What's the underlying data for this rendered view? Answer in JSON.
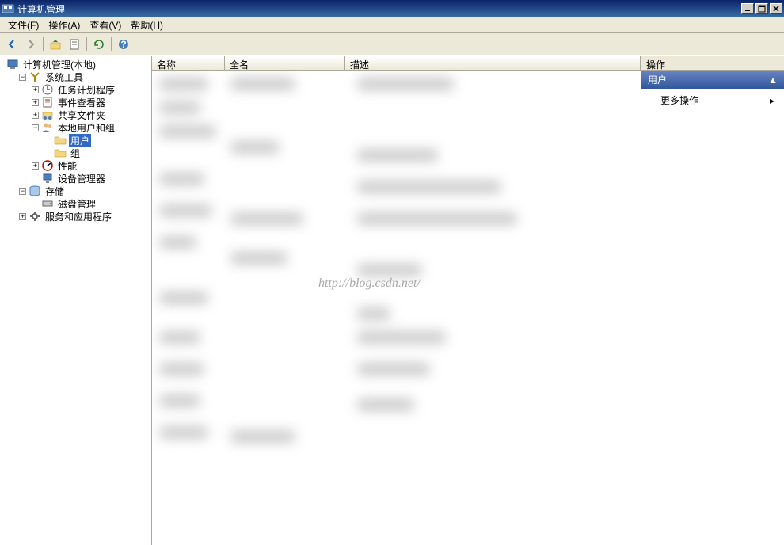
{
  "window": {
    "title": "计算机管理"
  },
  "menu": {
    "file": "文件(F)",
    "action": "操作(A)",
    "view": "查看(V)",
    "help": "帮助(H)"
  },
  "tree": {
    "root": "计算机管理(本地)",
    "system_tools": "系统工具",
    "task_scheduler": "任务计划程序",
    "event_viewer": "事件查看器",
    "shared_folders": "共享文件夹",
    "local_users": "本地用户和组",
    "users": "用户",
    "groups": "组",
    "performance": "性能",
    "device_manager": "设备管理器",
    "storage": "存储",
    "disk_management": "磁盘管理",
    "services_apps": "服务和应用程序"
  },
  "list": {
    "col_name": "名称",
    "col_fullname": "全名",
    "col_description": "描述"
  },
  "actions": {
    "header": "操作",
    "section": "用户",
    "more": "更多操作"
  },
  "watermark": "http://blog.csdn.net/"
}
